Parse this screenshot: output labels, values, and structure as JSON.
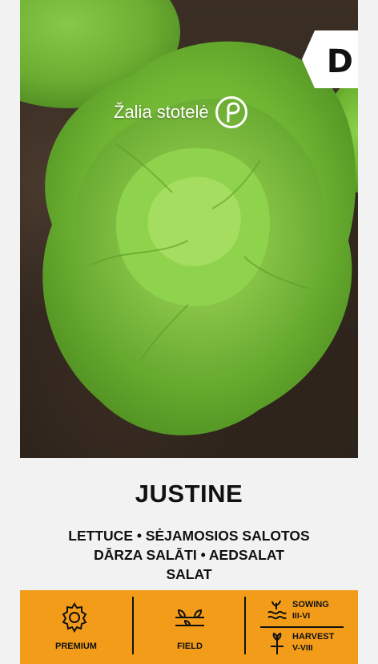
{
  "badge": "D",
  "brand": {
    "name": "Žalia stotelė"
  },
  "product": {
    "title": "JUSTINE",
    "subtitle_lines": [
      "LETTUCE • SĖJAMOSIOS SALOTOS",
      "DĀRZA SALĀTI • AEDSALAT",
      "SALAT"
    ]
  },
  "features": {
    "premium_label": "PREMIUM",
    "field_label": "FIELD",
    "sowing": {
      "label": "SOWING",
      "months": "III-VI"
    },
    "harvest": {
      "label": "HARVEST",
      "months": "V-VIII"
    }
  },
  "colors": {
    "band": "#f39c1a",
    "background": "#f2f2f2",
    "lettuce": "#7cbf3a",
    "soil": "#3b2f25"
  }
}
